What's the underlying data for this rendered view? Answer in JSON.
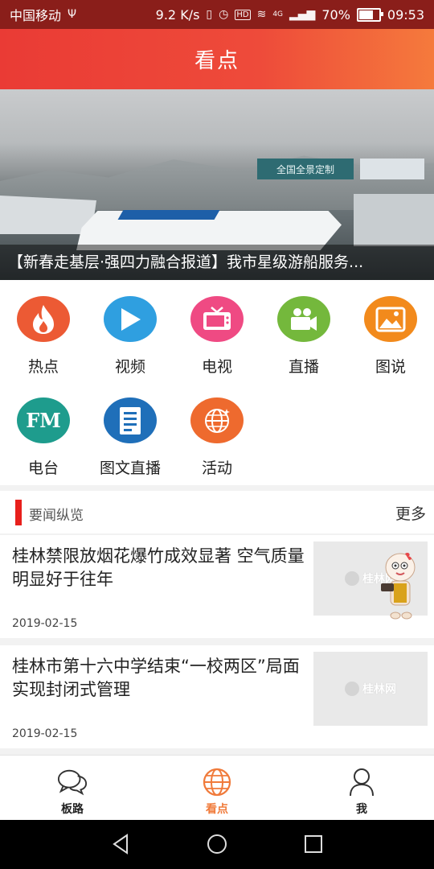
{
  "status_bar": {
    "carrier": "中国移动",
    "network_speed": "9.2 K/s",
    "signal_type": "4G",
    "battery": "70%",
    "battery_level": 0.7,
    "time": "09:53",
    "hd_badge": "HD"
  },
  "header": {
    "title": "看点"
  },
  "banner": {
    "caption": "【新春走基层·强四力融合报道】我市星级游船服务...",
    "sign_text": "全国全景定制"
  },
  "categories": [
    {
      "label": "热点",
      "icon": "fire-icon",
      "color": "#ec5a34"
    },
    {
      "label": "视频",
      "icon": "play-icon",
      "color": "#2f9fe0"
    },
    {
      "label": "电视",
      "icon": "tv-icon",
      "color": "#ef4a83"
    },
    {
      "label": "直播",
      "icon": "camera-icon",
      "color": "#74b83c"
    },
    {
      "label": "图说",
      "icon": "picture-icon",
      "color": "#f28a1c"
    },
    {
      "label": "电台",
      "icon": "fm-radio-icon",
      "color": "#1e9c8d"
    },
    {
      "label": "图文直播",
      "icon": "document-icon",
      "color": "#1f6fb9"
    },
    {
      "label": "活动",
      "icon": "globe-icon",
      "color": "#ee6a2e"
    }
  ],
  "section": {
    "title": "要闻纵览",
    "more": "更多"
  },
  "news": [
    {
      "headline": "桂林禁限放烟花爆竹成效显著 空气质量明显好于往年",
      "date": "2019-02-15",
      "thumb_text": "桂林网"
    },
    {
      "headline": "桂林市第十六中学结束“一校两区”局面 实现封闭式管理",
      "date": "2019-02-15",
      "thumb_text": "桂林网"
    }
  ],
  "tabbar": {
    "tabs": [
      {
        "label": "板路",
        "icon": "chat-bubbles-icon"
      },
      {
        "label": "看点",
        "icon": "globe-icon"
      },
      {
        "label": "我",
        "icon": "user-icon"
      }
    ],
    "active_index": 1,
    "active_color": "#f07a3a"
  },
  "navbar": {
    "buttons": [
      "back-icon",
      "home-icon",
      "recents-icon"
    ]
  }
}
